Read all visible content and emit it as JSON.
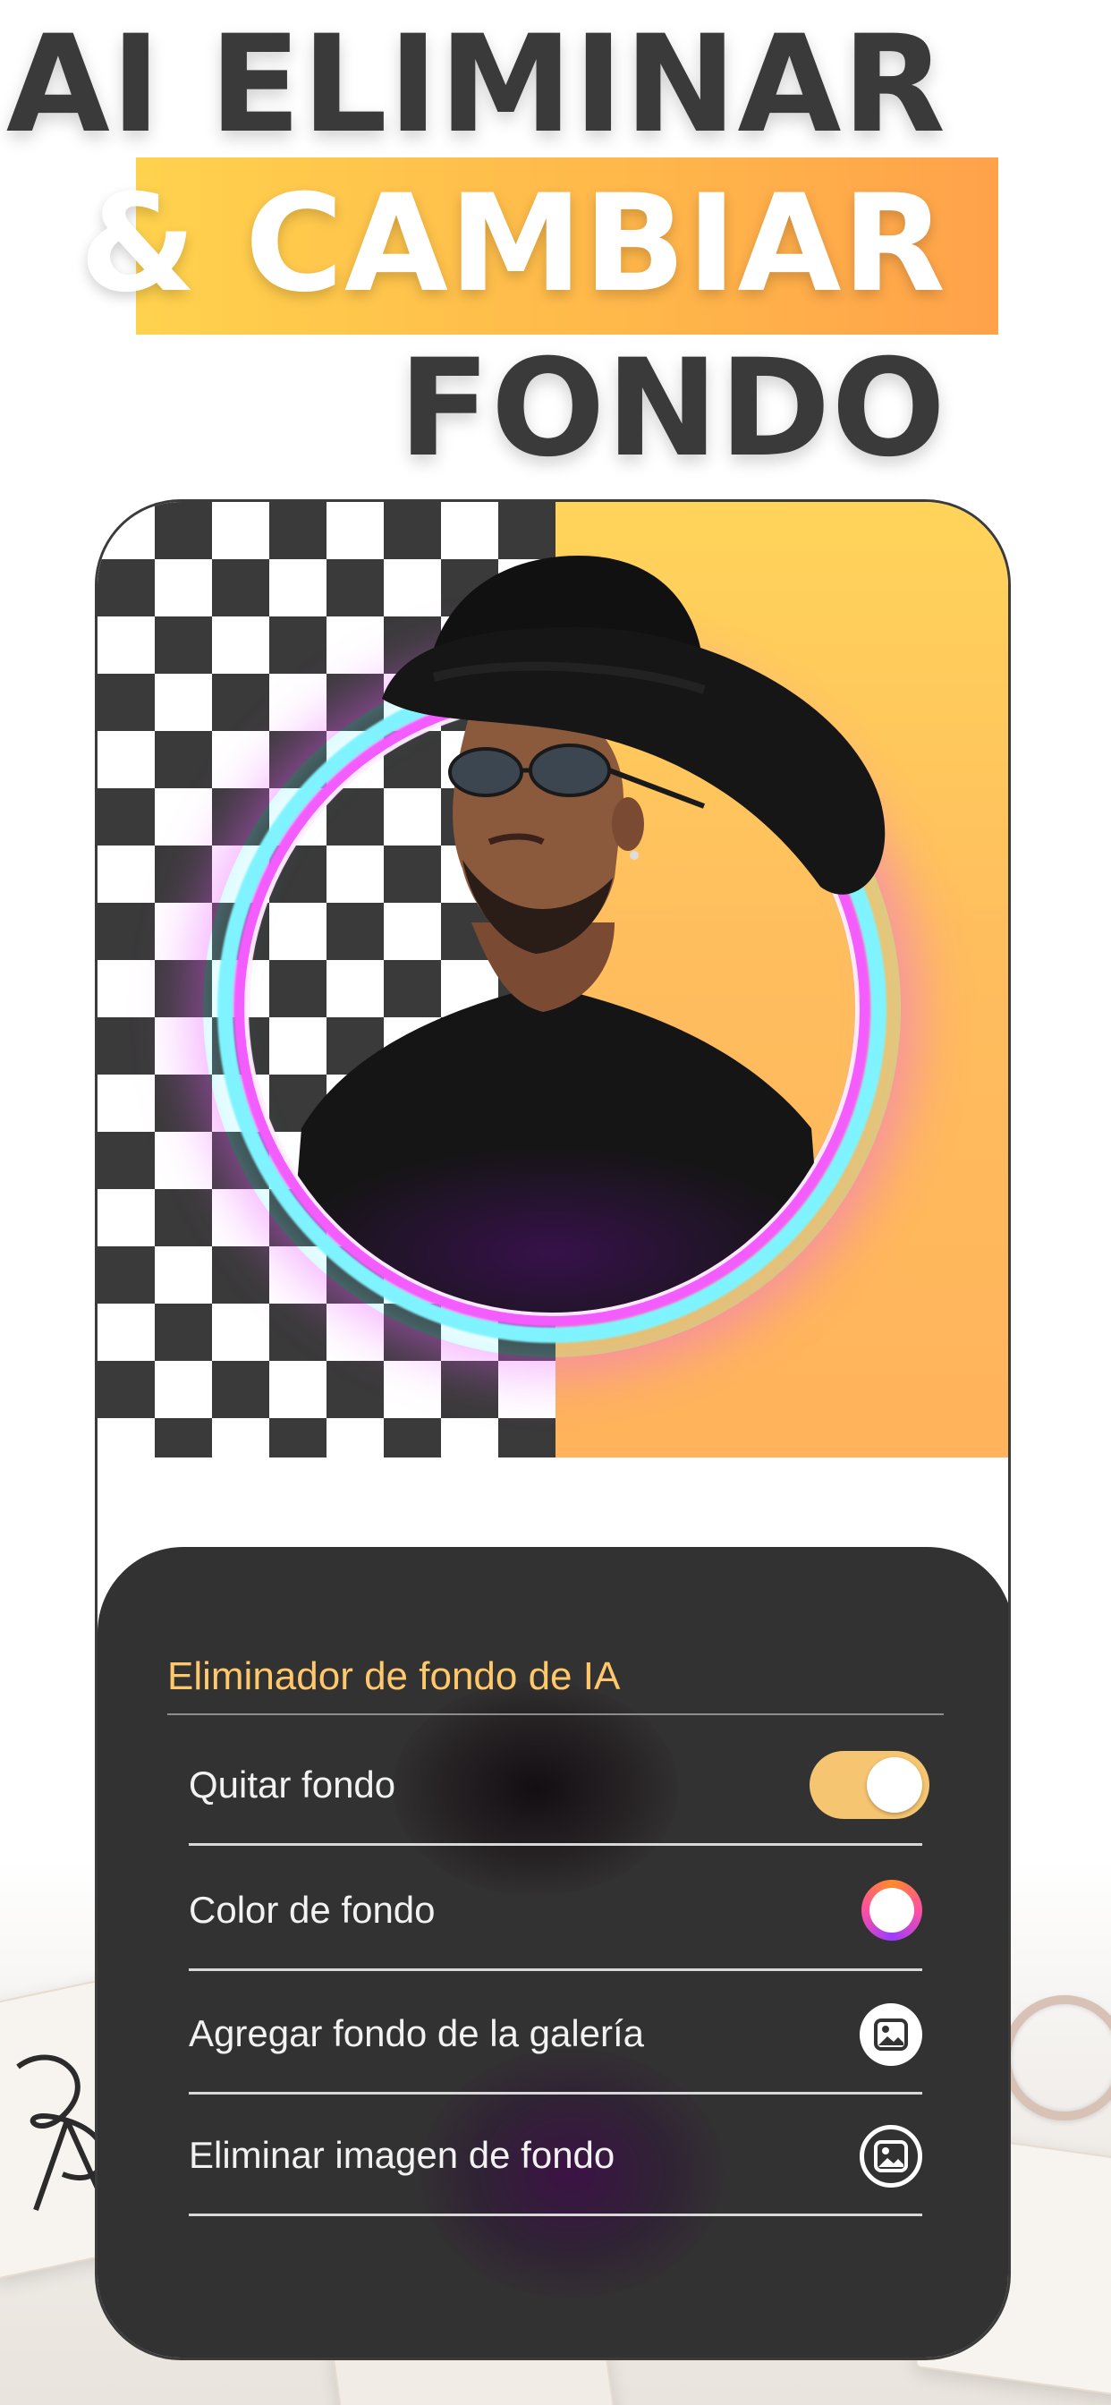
{
  "headline": {
    "line1": "AI ELIMINAR",
    "line2": "& CAMBIAR",
    "line3": "FONDO"
  },
  "panel": {
    "title": "Eliminador de fondo de IA",
    "rows": [
      {
        "label": "Quitar fondo",
        "control": "toggle",
        "value": true,
        "icon": "toggle"
      },
      {
        "label": "Color de fondo",
        "control": "color",
        "icon": "color-picker-icon"
      },
      {
        "label": "Agregar fondo de la galería",
        "control": "button",
        "icon": "image-gallery-icon"
      },
      {
        "label": "Eliminar imagen de fondo",
        "control": "button",
        "icon": "remove-image-icon"
      }
    ]
  },
  "colors": {
    "accent": "#ffc86a",
    "panel_bg": "#333232",
    "toggle_on": "#f5c571",
    "gradient_start": "#ffd24d",
    "gradient_end": "#ffa24a"
  }
}
